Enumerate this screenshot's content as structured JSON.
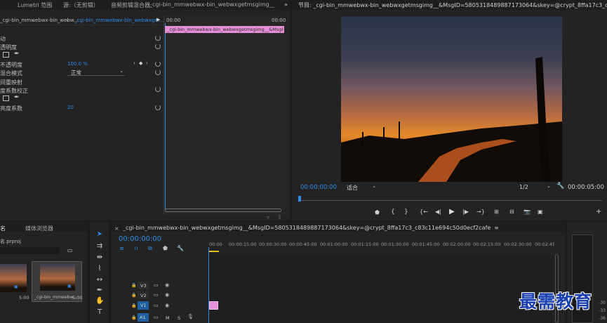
{
  "effect_controls": {
    "tabs": [
      "Lumetri 范围",
      "源:（无剪辑）",
      "音频剪辑混合器:"
    ],
    "tab_extra": "_cgi-bin_mmwebwx-bin_webwxgetmsgimg__&MsgID=5805",
    "source_label": "_cgi-bin_mmwebwx-bin_webw...",
    "clip_label": "_cgi-bin_mmwebwx-bin_webwxget...",
    "timeline_time_left": "00:00",
    "timeline_time_right": "00:00",
    "clip_bar_label": "_cgi-bin_mmwebwx-bin_webwxgetmsgimg__&MsgID=58",
    "rows": [
      {
        "label": "动",
        "value": ""
      },
      {
        "label": "透明度",
        "value": ""
      },
      {
        "label": "",
        "value": ""
      },
      {
        "label": "不透明度",
        "value": "100.0 %"
      },
      {
        "label": "混合模式",
        "value": "正常"
      },
      {
        "label": "间重映射",
        "value": ""
      },
      {
        "label": "度系数校正",
        "value": ""
      },
      {
        "label": "",
        "value": ""
      },
      {
        "label": "亮度系数",
        "value": "20"
      }
    ]
  },
  "program": {
    "title": "节目: _cgi-bin_mmwebwx-bin_webwxgetmsgimg__&MsgID=5805318489887173064&skey=@crypt_8ffa17c3_c83c11e694c50d0ecf2cafe7e8640e3&m",
    "timecode_left": "00:00:00:00",
    "fit_label": "适合",
    "resolution": "1/2",
    "timecode_right": "00:00:05:00"
  },
  "project": {
    "tabs": [
      "名",
      "媒体浏览器"
    ],
    "file": "名.prproj",
    "thumb1_duration": "5:00",
    "thumb2_label": "_cgi-bin_mmwebw...",
    "thumb2_duration": "5:00"
  },
  "timeline": {
    "title": "_cgi-bin_mmwebwx-bin_webwxgetmsgimg__&MsgID=5805318489887173064&skey=@crypt_8ffa17c3_c83c11e694c50d0ecf2cafe7e8640e3&mmweb_appid=wx_webfilehelper",
    "timecode": "00:00:00:00",
    "ruler": [
      "00:00",
      "00:00:15:00",
      "00:00:30:00",
      "00:00:45:00",
      "00:01:00:00",
      "00:01:15:00",
      "00:01:30:00",
      "00:01:45:00",
      "00:02:00:00",
      "00:02:15:00",
      "00:02:30:00",
      "00:02:45:"
    ],
    "tracks": [
      "V3",
      "V2",
      "V1",
      "A1"
    ],
    "track_m": "M",
    "track_s": "S"
  },
  "vu": [
    "-30",
    "-33",
    "-36"
  ],
  "watermark": "最需教育",
  "colors": {
    "accent": "#2d8ceb",
    "clip_pink": "#e58fd8",
    "panel": "#232323"
  }
}
